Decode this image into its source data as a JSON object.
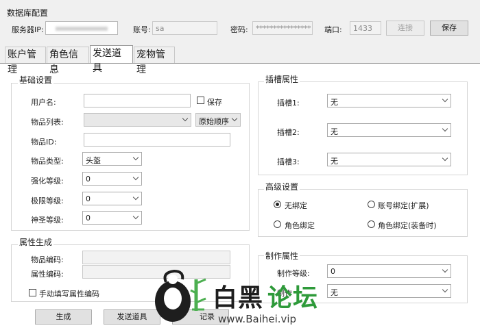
{
  "db": {
    "title": "数据库配置",
    "server_label": "服务器IP:",
    "account_label": "账号:",
    "account_value": "sa",
    "password_label": "密码:",
    "password_value": "****************",
    "port_label": "端口:",
    "port_value": "1433",
    "connect_label": "连接",
    "save_label": "保存"
  },
  "tabs": [
    "账户管理",
    "角色信息",
    "发送道具",
    "宠物管理"
  ],
  "basic": {
    "title": "基础设置",
    "username_label": "用户名:",
    "save_check_label": "保存",
    "item_list_label": "物品列表:",
    "order_value": "原始顺序",
    "item_id_label": "物品ID:",
    "item_type_label": "物品类型:",
    "item_type_value": "头盔",
    "enhance_label": "强化等级:",
    "enhance_value": "0",
    "limit_label": "极限等级:",
    "limit_value": "0",
    "holy_label": "神圣等级:",
    "holy_value": "0"
  },
  "attr": {
    "title": "属性生成",
    "item_code_label": "物品编码:",
    "attr_code_label": "属性编码:",
    "manual_label": "手动填写属性编码"
  },
  "buttons": {
    "generate": "生成",
    "send": "发送道具",
    "record": "记录"
  },
  "slots": {
    "title": "插槽属性",
    "slot1_label": "插槽1:",
    "slot1_value": "无",
    "slot2_label": "插槽2:",
    "slot2_value": "无",
    "slot3_label": "插槽3:",
    "slot3_value": "无"
  },
  "advanced": {
    "title": "高级设置",
    "opt1": "无绑定",
    "opt2": "账号绑定(扩展)",
    "opt3": "角色绑定",
    "opt4": "角色绑定(装备时)"
  },
  "craft": {
    "title": "制作属性",
    "level_label": "制作等级:",
    "level_value": "0",
    "other_label": "制作",
    "other_value": "无"
  },
  "watermark": {
    "text_a": "白黑",
    "text_b": "论坛",
    "url": "www.Baihei.vip"
  }
}
